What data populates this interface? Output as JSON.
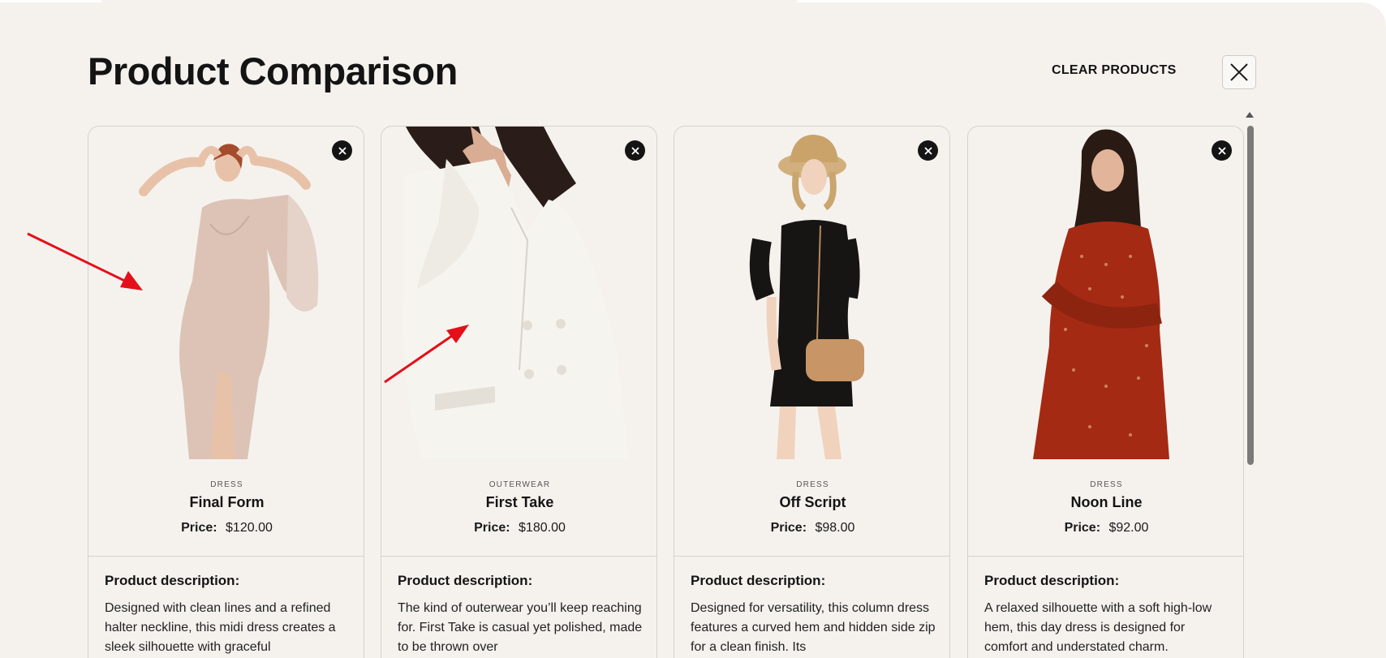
{
  "page": {
    "title": "Product Comparison",
    "clear_label": "CLEAR PRODUCTS",
    "description_heading": "Product description:",
    "price_label": "Price:"
  },
  "products": [
    {
      "category": "DRESS",
      "name": "Final Form",
      "price": "$120.00",
      "description": "Designed with clean lines and a refined halter neckline, this midi dress creates a sleek silhouette with graceful",
      "image_subject": "woman in pink sequin dress"
    },
    {
      "category": "OUTERWEAR",
      "name": "First Take",
      "price": "$180.00",
      "description": "The kind of outerwear you’ll keep reaching for. First Take is casual yet polished, made to be thrown over",
      "image_subject": "white double-breasted blazer"
    },
    {
      "category": "DRESS",
      "name": "Off Script",
      "price": "$98.00",
      "description": "Designed for versatility, this column dress features a curved hem and hidden side zip for a clean finish. Its",
      "image_subject": "woman in black dress with straw hat and tan bag"
    },
    {
      "category": "DRESS",
      "name": "Noon Line",
      "price": "$92.00",
      "description": "A relaxed silhouette with a soft high-low hem, this day dress is designed for comfort and understated charm.",
      "image_subject": "woman in red patterned dress"
    }
  ],
  "colors": {
    "background": "#f5f2ee",
    "text": "#141414",
    "annotation_arrow": "#e3101a"
  },
  "icons": {
    "close": "close-icon",
    "remove": "remove-circle-icon"
  }
}
